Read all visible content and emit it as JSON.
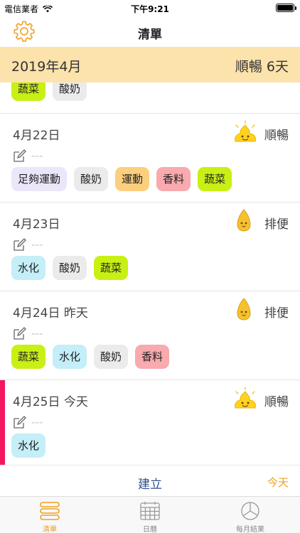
{
  "status_bar": {
    "carrier": "電信業者",
    "time": "下午9:21"
  },
  "nav": {
    "title": "清單"
  },
  "month_header": {
    "month": "2019年4月",
    "summary": "順暢  6天"
  },
  "partial_entry": {
    "tags": [
      "蔬菜",
      "酸奶"
    ]
  },
  "entries": [
    {
      "date": "4月22日",
      "status": "順暢",
      "mascot": "smiling-poop-icon",
      "note": "---",
      "tags": [
        "足夠運動",
        "酸奶",
        "運動",
        "香料",
        "蔬菜"
      ]
    },
    {
      "date": "4月23日",
      "status": "排便",
      "mascot": "bean-icon",
      "note": "---",
      "tags": [
        "水化",
        "酸奶",
        "蔬菜"
      ]
    },
    {
      "date": "4月24日 昨天",
      "status": "排便",
      "mascot": "bean-icon",
      "note": "---",
      "tags": [
        "蔬菜",
        "水化",
        "酸奶",
        "香料"
      ]
    },
    {
      "date": "4月25日 今天",
      "status": "順暢",
      "mascot": "smiling-poop-icon",
      "note": "---",
      "tags": [
        "水化"
      ]
    }
  ],
  "action_bar": {
    "create": "建立",
    "today": "今天"
  },
  "tabs": [
    {
      "label": "清單",
      "icon": "list-icon"
    },
    {
      "label": "日曆",
      "icon": "calendar-icon"
    },
    {
      "label": "每月結果",
      "icon": "pie-chart-icon"
    }
  ],
  "colors": {
    "accent": "#f0a020",
    "month_header_bg": "#fce2ab",
    "today_marker": "#f2175f",
    "create_text": "#2c4f8a"
  }
}
